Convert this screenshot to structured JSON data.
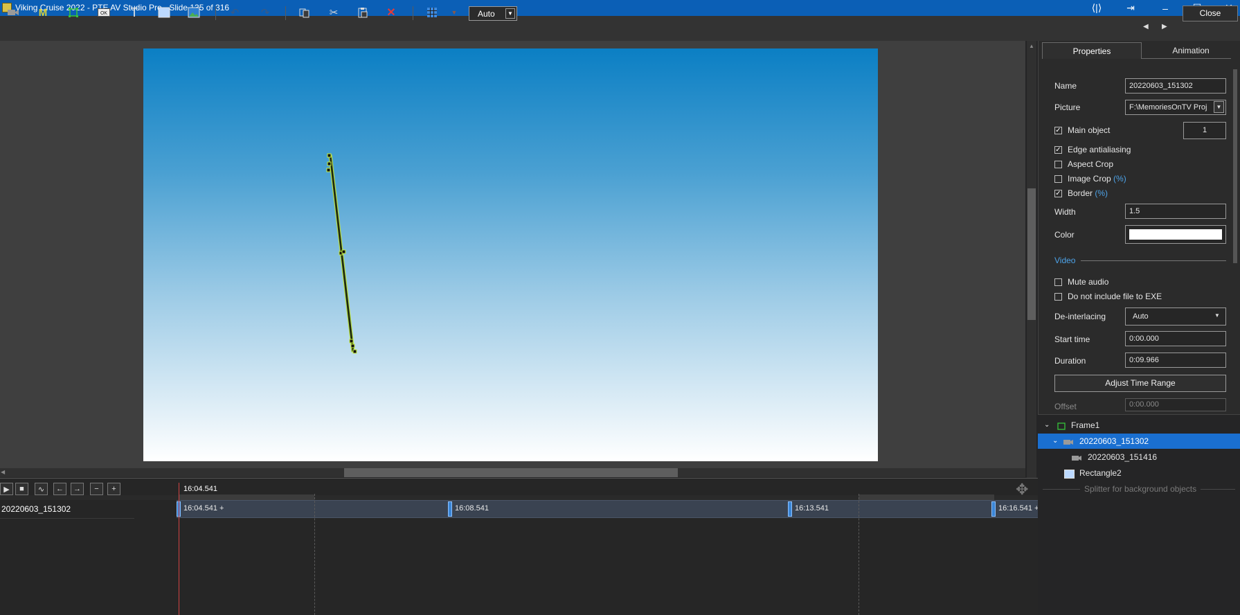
{
  "window": {
    "title": "Viking Cruise 2022 - PTE AV Studio Pro - Slide 135 of 316",
    "controls": [
      "restore-side",
      "toggle-view",
      "minimize",
      "maximize",
      "close"
    ]
  },
  "toolbar": {
    "zoom_value": "Auto",
    "close_label": "Close",
    "icons": [
      "video-icon",
      "mask-icon",
      "frame-icon",
      "button-icon",
      "text-icon",
      "rectangle-icon",
      "image-icon",
      "undo-icon",
      "redo-icon",
      "copy-icon",
      "cut-icon",
      "paste-icon",
      "delete-icon",
      "grid-icon",
      "grid-dropdown-icon"
    ]
  },
  "timeline": {
    "current_time": "16:04.541",
    "track_name": "20220603_151302",
    "markers": [
      {
        "label": "16:04.541 +"
      },
      {
        "label": "16:08.541"
      },
      {
        "label": "16:13.541"
      },
      {
        "label": "16:16.541 +"
      }
    ]
  },
  "panel": {
    "tabs": [
      "Properties",
      "Animation"
    ],
    "name_label": "Name",
    "name_value": "20220603_151302",
    "picture_label": "Picture",
    "picture_value": "F:\\MemoriesOnTV Proj",
    "main_object_label": "Main object",
    "main_object_value": "1",
    "edge_aa_label": "Edge antialiasing",
    "aspect_crop_label": "Aspect Crop",
    "image_crop_label": "Image Crop",
    "image_crop_pct": "(%)",
    "border_label": "Border",
    "border_pct": "(%)",
    "width_label": "Width",
    "width_value": "1.5",
    "color_label": "Color",
    "video_section": "Video",
    "mute_label": "Mute audio",
    "no_exe_label": "Do not include file to EXE",
    "deinterlace_label": "De-interlacing",
    "deinterlace_value": "Auto",
    "start_label": "Start time",
    "start_value": "0:00.000",
    "duration_label": "Duration",
    "duration_value": "0:09.966",
    "adjust_button": "Adjust Time Range",
    "offset_label": "Offset",
    "offset_value": "0:00.000",
    "checks": {
      "main_object": true,
      "edge_aa": true,
      "aspect_crop": false,
      "image_crop": false,
      "border": true,
      "mute": false,
      "no_exe": false
    }
  },
  "tree": {
    "items": [
      {
        "label": "Frame1"
      },
      {
        "label": "20220603_151302"
      },
      {
        "label": "20220603_151416"
      },
      {
        "label": "Rectangle2"
      }
    ],
    "splitter": "Splitter for background objects"
  }
}
